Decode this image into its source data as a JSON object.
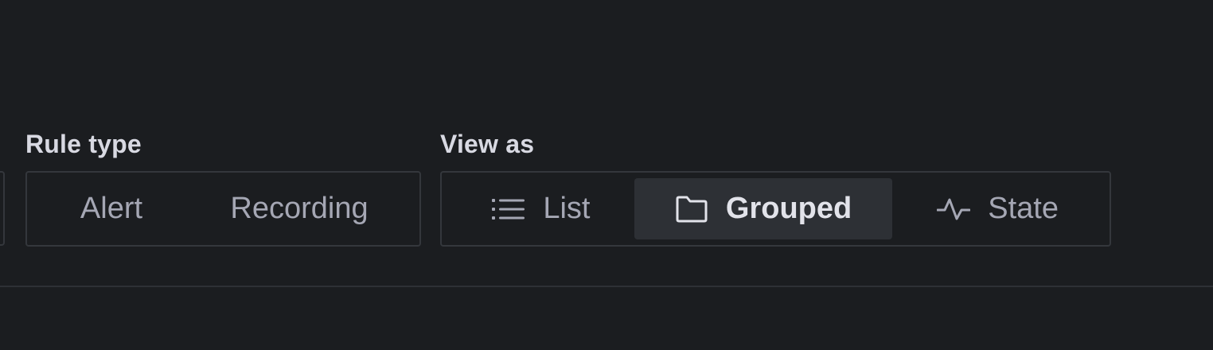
{
  "filters": {
    "rule_type": {
      "label": "Rule type",
      "options": [
        {
          "label": "Alert",
          "selected": false
        },
        {
          "label": "Recording",
          "selected": false
        }
      ]
    },
    "view_as": {
      "label": "View as",
      "options": [
        {
          "label": "List",
          "icon": "list-icon",
          "selected": false
        },
        {
          "label": "Grouped",
          "icon": "folder-icon",
          "selected": true
        },
        {
          "label": "State",
          "icon": "heartbeat-icon",
          "selected": false
        }
      ]
    }
  },
  "colors": {
    "background": "#1b1d20",
    "border": "#34373c",
    "selected_background": "#2d3035",
    "label_text": "#d8d9e2",
    "option_text": "#a5a7b4",
    "selected_text": "#e2e3ea"
  }
}
